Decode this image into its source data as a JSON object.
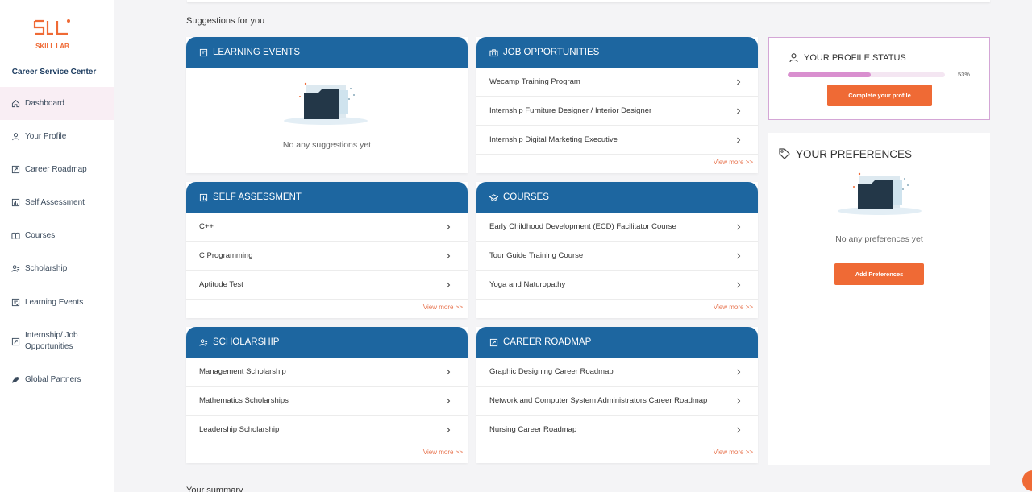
{
  "sidebar": {
    "brand": "Career Service Center",
    "logo_text": "SKILL LAB",
    "items": [
      {
        "label": "Dashboard",
        "icon": "home-icon"
      },
      {
        "label": "Your Profile",
        "icon": "user-icon"
      },
      {
        "label": "Career Roadmap",
        "icon": "roadmap-icon"
      },
      {
        "label": "Self Assessment",
        "icon": "assessment-icon"
      },
      {
        "label": "Courses",
        "icon": "book-icon"
      },
      {
        "label": "Scholarship",
        "icon": "scholarship-icon"
      },
      {
        "label": "Learning Events",
        "icon": "events-icon"
      },
      {
        "label": "Internship/ Job Opportunities",
        "icon": "briefcase-icon"
      },
      {
        "label": "Global Partners",
        "icon": "handshake-icon"
      }
    ]
  },
  "main": {
    "suggestions_title": "Suggestions for you",
    "summary_title": "Your summary",
    "view_more": "View more >>",
    "cards": {
      "learning_events": {
        "title": "LEARNING EVENTS",
        "empty": "No any suggestions yet"
      },
      "job_opportunities": {
        "title": "JOB OPPORTUNITIES",
        "items": [
          "Wecamp Training Program",
          "Internship Furniture Designer / Interior Designer",
          "Internship Digital Marketing Executive"
        ]
      },
      "self_assessment": {
        "title": "SELF ASSESSMENT",
        "items": [
          "C++",
          "C Programming",
          "Aptitude Test"
        ]
      },
      "courses": {
        "title": "COURSES",
        "items": [
          "Early Childhood Development (ECD) Facilitator Course",
          "Tour Guide Training Course",
          "Yoga and Naturopathy"
        ]
      },
      "scholarship": {
        "title": "SCHOLARSHIP",
        "items": [
          "Management Scholarship",
          "Mathematics Scholarships",
          "Leadership Scholarship"
        ]
      },
      "career_roadmap": {
        "title": "CAREER ROADMAP",
        "items": [
          "Graphic Designing Career Roadmap",
          "Network and Computer System Administrators Career Roadmap",
          "Nursing Career Roadmap"
        ]
      }
    }
  },
  "profile_status": {
    "title": "YOUR PROFILE STATUS",
    "percent": 53,
    "percent_label": "53%",
    "button": "Complete your profile"
  },
  "preferences": {
    "title": "YOUR PREFERENCES",
    "empty": "No any preferences yet",
    "button": "Add Preferences"
  },
  "colors": {
    "header_blue": "#1d66a0",
    "accent_orange": "#ef6a35",
    "progress_pink": "#d98fcf",
    "active_nav": "#f9eef4"
  }
}
